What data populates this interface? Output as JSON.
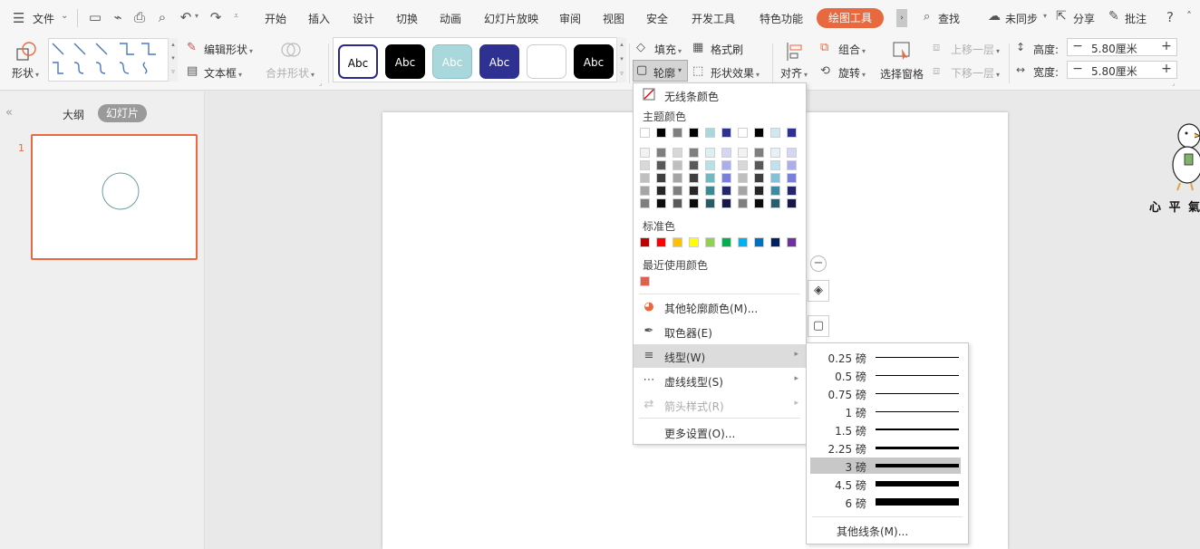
{
  "menubar": {
    "file_label": "文件",
    "tabs": [
      {
        "label": "开始",
        "active": false
      },
      {
        "label": "插入",
        "active": false
      },
      {
        "label": "设计",
        "active": false
      },
      {
        "label": "切换",
        "active": false
      },
      {
        "label": "动画",
        "active": false
      },
      {
        "label": "幻灯片放映",
        "active": false
      },
      {
        "label": "审阅",
        "active": false
      },
      {
        "label": "视图",
        "active": false
      },
      {
        "label": "安全",
        "active": false
      },
      {
        "label": "开发工具",
        "active": false
      },
      {
        "label": "特色功能",
        "active": false
      },
      {
        "label": "绘图工具",
        "active": true
      }
    ],
    "search_label": "查找",
    "sync_label": "未同步",
    "share_label": "分享",
    "comment_label": "批注",
    "help_label": "?"
  },
  "ribbon": {
    "shape_label": "形状",
    "edit_shape_label": "编辑形状",
    "textbox_label": "文本框",
    "merge_shape_label": "合并形状",
    "style_samples": [
      {
        "text": "Abc",
        "bg": "#ffffff",
        "fg": "#000000",
        "border": "#2a2a8a"
      },
      {
        "text": "Abc",
        "bg": "#000000",
        "fg": "#ffffff",
        "border": "#000000"
      },
      {
        "text": "Abc",
        "bg": "#a8d8dc",
        "fg": "#ffffff",
        "border": "#8cc2c7"
      },
      {
        "text": "Abc",
        "bg": "#2e3192",
        "fg": "#ffffff",
        "border": "#2e3192"
      },
      {
        "text": "",
        "bg": "#ffffff",
        "fg": "#000000",
        "border": "#cccccc"
      },
      {
        "text": "Abc",
        "bg": "#000000",
        "fg": "#ffffff",
        "border": "#000000"
      }
    ],
    "fill_label": "填充",
    "format_brush_label": "格式刷",
    "outline_label": "轮廓",
    "shape_effect_label": "形状效果",
    "align_label": "对齐",
    "group_label": "组合",
    "rotate_label": "旋转",
    "selection_pane_label": "选择窗格",
    "bring_forward_label": "上移一层",
    "send_backward_label": "下移一层",
    "height_label": "高度:",
    "height_value": "5.80厘米",
    "width_label": "宽度:",
    "width_value": "5.80厘米"
  },
  "left_panel": {
    "outline_tab": "大纲",
    "slides_tab": "幻灯片",
    "slide_number": "1"
  },
  "outline_menu": {
    "no_line_label": "无线条颜色",
    "theme_colors_title": "主题颜色",
    "theme_top_row": [
      "#ffffff",
      "#000000",
      "#7f7f7f",
      "#000000",
      "#a8d8dc",
      "#2e3192",
      "#ffffff",
      "#000000",
      "#d0e8f0",
      "#2e3192"
    ],
    "theme_shades": [
      [
        "#f2f2f2",
        "#7f7f7f",
        "#d8d8d8",
        "#7f7f7f",
        "#dcf0f2",
        "#d5d6f3",
        "#f2f2f2",
        "#7f7f7f",
        "#e6f2f6",
        "#d5d6f3"
      ],
      [
        "#d8d8d8",
        "#595959",
        "#bfbfbf",
        "#595959",
        "#b9e1e5",
        "#abaee8",
        "#d8d8d8",
        "#595959",
        "#c2e1ec",
        "#abaee8"
      ],
      [
        "#bfbfbf",
        "#3f3f3f",
        "#a5a5a5",
        "#3f3f3f",
        "#71b9c1",
        "#7a7edc",
        "#bfbfbf",
        "#3f3f3f",
        "#85c1d6",
        "#7a7edc"
      ],
      [
        "#a5a5a5",
        "#262626",
        "#7f7f7f",
        "#262626",
        "#3b8a93",
        "#23256d",
        "#a5a5a5",
        "#262626",
        "#3e8aa3",
        "#23256d"
      ],
      [
        "#7f7f7f",
        "#0c0c0c",
        "#595959",
        "#0c0c0c",
        "#275c62",
        "#171849",
        "#7f7f7f",
        "#0c0c0c",
        "#295c6d",
        "#171849"
      ]
    ],
    "standard_colors_title": "标准色",
    "standard_colors": [
      "#c00000",
      "#ff0000",
      "#ffc000",
      "#ffff00",
      "#92d050",
      "#00b050",
      "#00b0f0",
      "#0070c0",
      "#002060",
      "#7030a0"
    ],
    "recent_colors_title": "最近使用颜色",
    "recent_colors": [
      "#e06050"
    ],
    "more_colors_label": "其他轮廓颜色(M)...",
    "eyedropper_label": "取色器(E)",
    "line_type_label": "线型(W)",
    "dash_type_label": "虚线线型(S)",
    "arrow_style_label": "箭头样式(R)",
    "more_settings_label": "更多设置(O)..."
  },
  "line_weights": {
    "items": [
      {
        "label": "0.25 磅",
        "pt": 0.25,
        "selected": false
      },
      {
        "label": "0.5 磅",
        "pt": 0.5,
        "selected": false
      },
      {
        "label": "0.75 磅",
        "pt": 0.75,
        "selected": false
      },
      {
        "label": "1 磅",
        "pt": 1,
        "selected": false
      },
      {
        "label": "1.5 磅",
        "pt": 1.5,
        "selected": false
      },
      {
        "label": "2.25 磅",
        "pt": 2.25,
        "selected": false
      },
      {
        "label": "3 磅",
        "pt": 3,
        "selected": true
      },
      {
        "label": "4.5 磅",
        "pt": 4.5,
        "selected": false
      },
      {
        "label": "6 磅",
        "pt": 6,
        "selected": false
      }
    ],
    "more_lines_label": "其他线条(M)..."
  },
  "sticker": {
    "text": "心 平 氣"
  },
  "colors": {
    "accent": "#e8683f",
    "selected_row": "#c8c8c8"
  }
}
